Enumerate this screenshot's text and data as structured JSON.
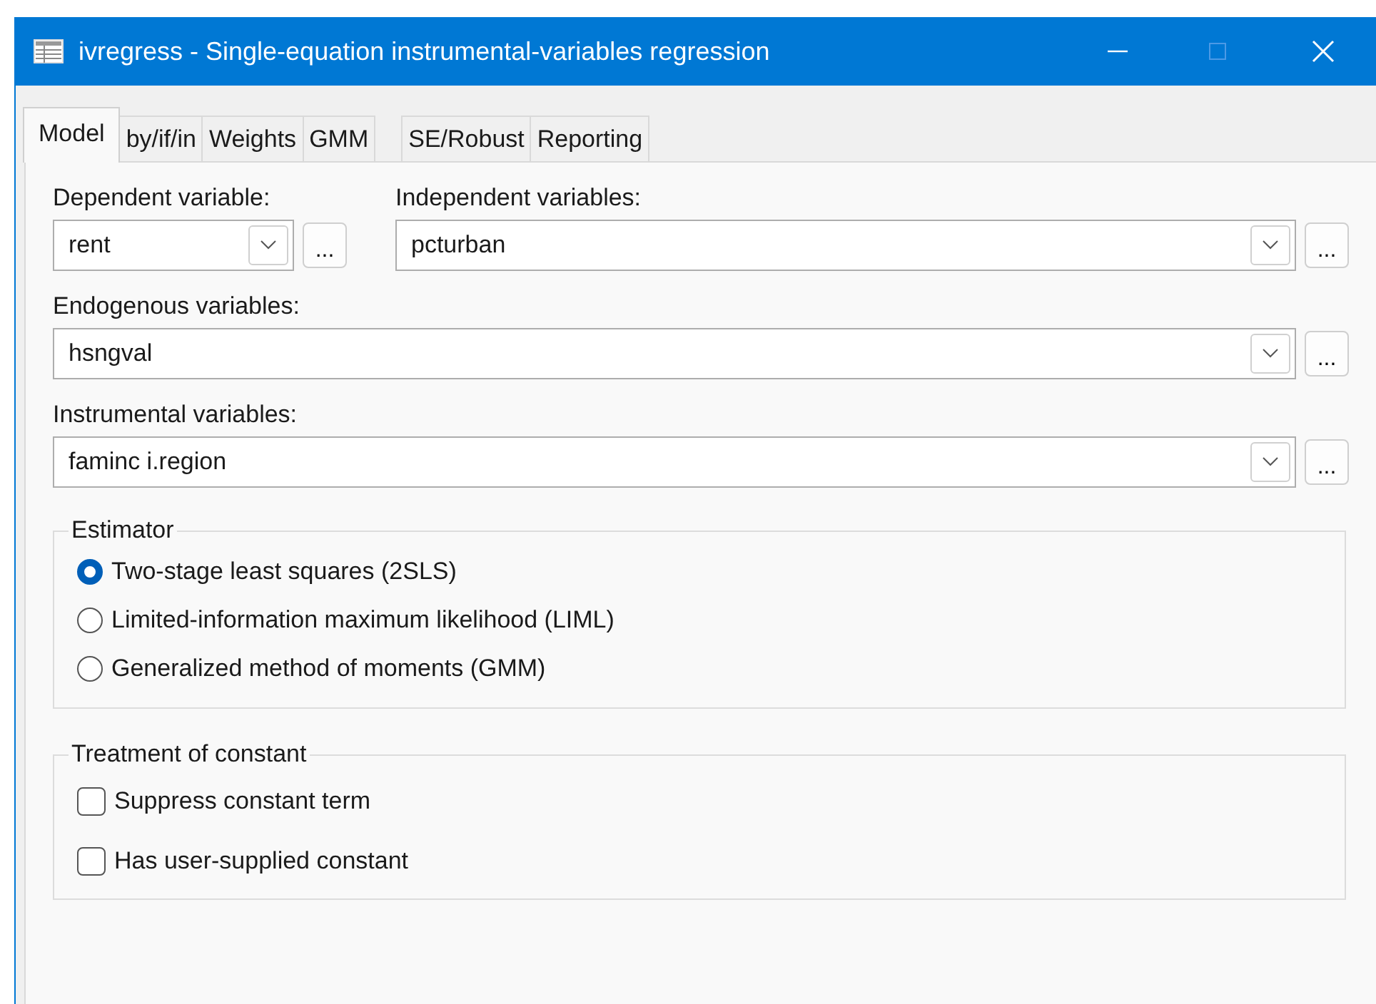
{
  "window": {
    "title": "ivregress - Single-equation instrumental-variables regression",
    "maximize_disabled": true
  },
  "tabs": [
    {
      "label": "Model",
      "selected": true
    },
    {
      "label": "by/if/in",
      "selected": false
    },
    {
      "label": "Weights",
      "selected": false
    },
    {
      "label": "GMM",
      "selected": false
    },
    {
      "label": "SE/Robust",
      "selected": false
    },
    {
      "label": "Reporting",
      "selected": false
    }
  ],
  "top_fields": [
    {
      "label": "Dependent variable:",
      "value": "rent",
      "browse": "...",
      "kind": "narrow"
    },
    {
      "label": "Independent variables:",
      "value": "pcturban",
      "browse": "...",
      "kind": "wide"
    }
  ],
  "fields": [
    {
      "label": "Endogenous variables:",
      "value": "hsngval",
      "browse": "..."
    },
    {
      "label": "Instrumental variables:",
      "value": "faminc i.region",
      "browse": "..."
    }
  ],
  "estimator": {
    "title": "Estimator",
    "options": [
      {
        "label": "Two-stage least squares (2SLS)",
        "selected": true
      },
      {
        "label": "Limited-information maximum likelihood (LIML)",
        "selected": false
      },
      {
        "label": "Generalized method of moments (GMM)",
        "selected": false
      }
    ]
  },
  "constant": {
    "title": "Treatment of constant",
    "options": [
      {
        "label": "Suppress constant term",
        "checked": false
      },
      {
        "label": "Has user-supplied constant",
        "checked": false
      }
    ]
  }
}
